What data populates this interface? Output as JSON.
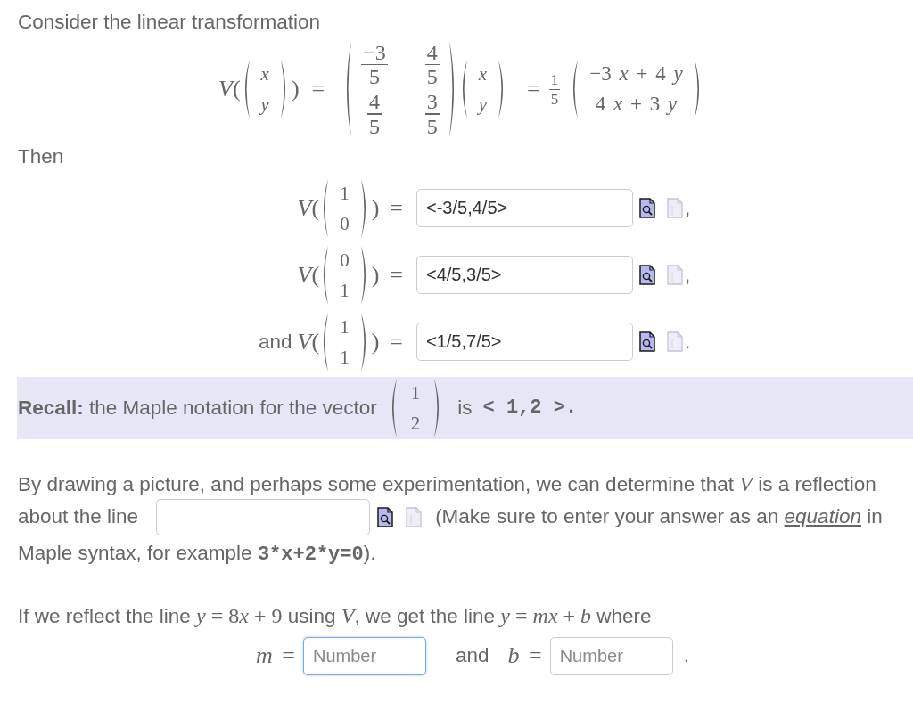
{
  "intro": "Consider the linear transformation",
  "definition": {
    "function": "*V*(",
    "input_vector": {
      "kind": "symbolic",
      "entries": [
        "x",
        "y"
      ]
    },
    "close": ")",
    "equals": "=",
    "matrix": [
      [
        {
          "numerator": "−3",
          "denominator": "5"
        },
        {
          "numerator": "4",
          "denominator": "5"
        }
      ],
      [
        {
          "numerator": "4",
          "denominator": "5"
        },
        {
          "numerator": "3",
          "denominator": "5"
        }
      ]
    ],
    "vector": {
      "kind": "symbolic",
      "entries": [
        "x",
        "y"
      ]
    },
    "equals_2": "=",
    "scalar": {
      "numerator": "1",
      "denominator": "5"
    },
    "result": {
      "kind": "expression",
      "entries": [
        "−3 *x* + 4 *y*",
        "4 *x* + 3 *y*"
      ]
    }
  },
  "then": "Then",
  "answers": [
    {
      "function": "*V*(",
      "vector": {
        "kind": "numeric",
        "entries": [
          "1",
          "0"
        ]
      },
      "close": ")",
      "equals": "=",
      "value": "<-3/5,4/5>",
      "focused": false,
      "punctuation": ","
    },
    {
      "function": "*V*(",
      "vector": {
        "kind": "numeric",
        "entries": [
          "0",
          "1"
        ]
      },
      "close": ")",
      "equals": "=",
      "value": "<4/5,3/5>",
      "focused": false,
      "punctuation": ","
    },
    {
      "prefix": "and",
      "function": "*V*(",
      "vector": {
        "kind": "numeric",
        "entries": [
          "1",
          "1"
        ]
      },
      "close": ")",
      "equals": "=",
      "value": "<1/5,7/5>",
      "focused": false,
      "punctuation": "."
    }
  ],
  "recall": {
    "text": "**Recall:** the Maple notation for the vector",
    "vector": {
      "kind": "numeric",
      "entries": [
        "1",
        "2"
      ]
    },
    "after": "is",
    "code": "< 1,2 >."
  },
  "reflection": {
    "text": "By drawing a picture, and perhaps some experimentation, we can determine that *V* is a reflection",
    "lead": "about the line",
    "line_field": {
      "focused": false
    },
    "note": {
      "before": "(Make sure to enter your answer as an",
      "link": "equation",
      "after": "in"
    },
    "example_line": {
      "text": "Maple syntax, for example",
      "example": "3*x+2*y=0",
      "end": ")."
    }
  },
  "question": {
    "segments": [
      {
        "kind": "text",
        "text": "If we reflect the line "
      },
      {
        "kind": "math",
        "text": "*y* = 8"
      },
      {
        "kind": "math",
        "text": "*x* + 9"
      },
      {
        "kind": "text",
        "text": " using "
      },
      {
        "kind": "math",
        "text": "*V*"
      },
      {
        "kind": "text",
        "text": ", we get the line "
      },
      {
        "kind": "math",
        "text": "*y* = *mx* + *b*"
      },
      {
        "kind": "text",
        "text": " where"
      }
    ],
    "fields": [
      {
        "label": "*m* =",
        "placeholder": "Number",
        "focused": true
      },
      {
        "prefix": "and",
        "label": "*b* =",
        "placeholder": "Number",
        "focused": false
      }
    ],
    "end": "."
  }
}
